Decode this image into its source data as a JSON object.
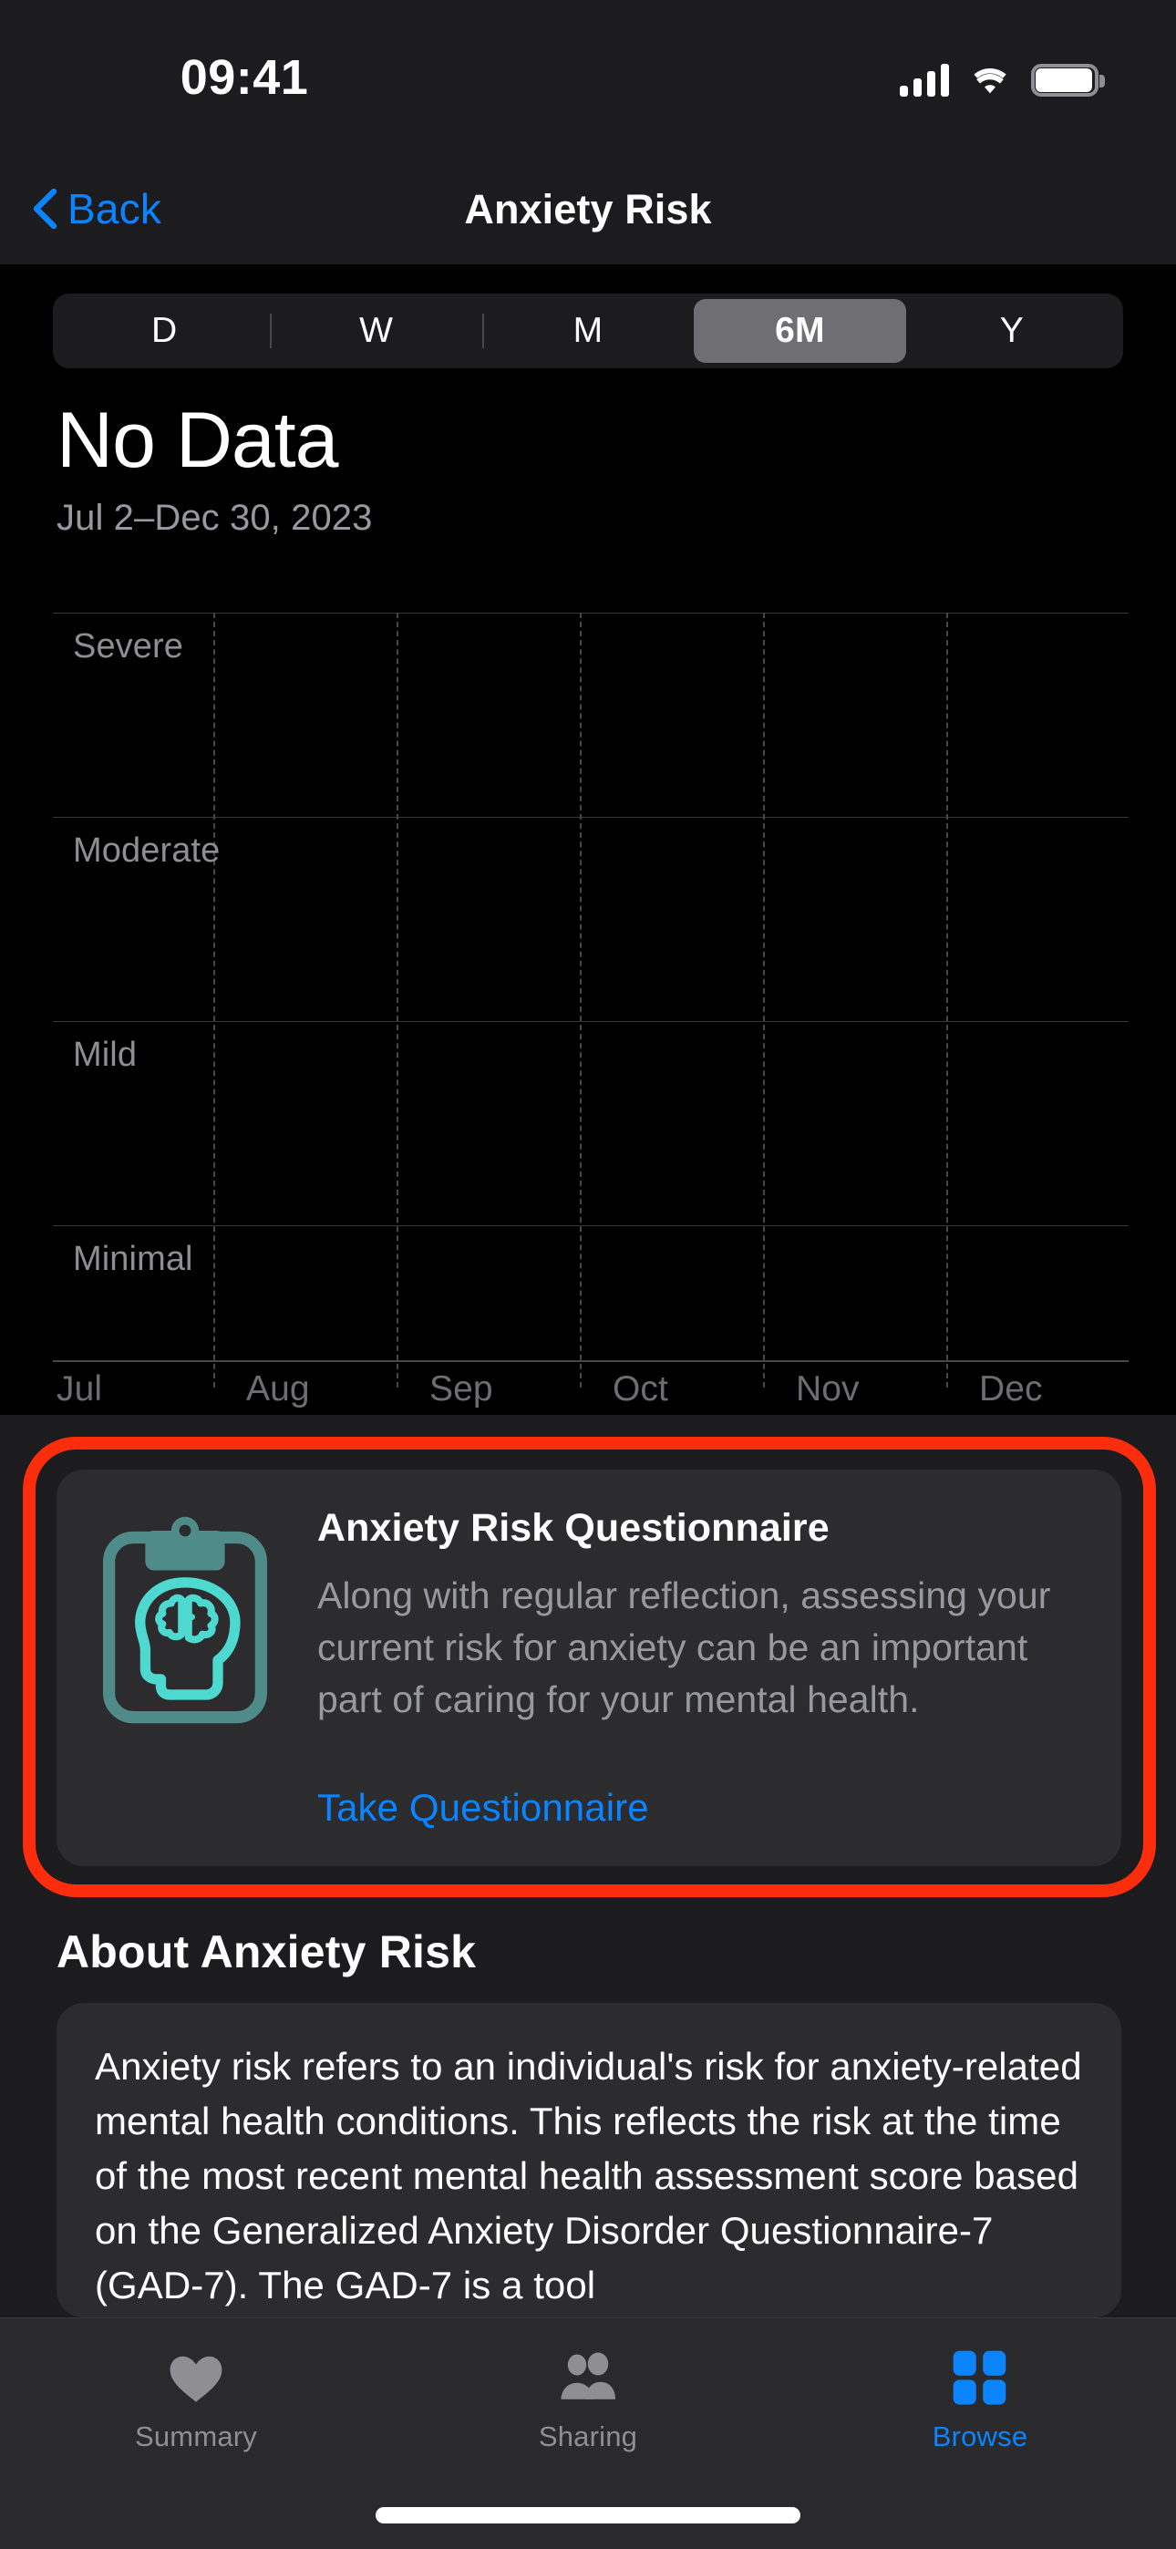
{
  "status_bar": {
    "time": "09:41",
    "cellular_icon": "cellular-bars-icon",
    "wifi_icon": "wifi-icon",
    "battery_icon": "battery-icon"
  },
  "nav_bar": {
    "back_label": "Back",
    "back_icon": "chevron-left-icon",
    "title": "Anxiety Risk"
  },
  "range_selector": {
    "options": [
      "D",
      "W",
      "M",
      "6M",
      "Y"
    ],
    "selected": "6M"
  },
  "summary": {
    "value": "No Data",
    "date_range": "Jul 2–Dec 30, 2023"
  },
  "chart_data": {
    "type": "line",
    "title": "No Data",
    "subtitle": "Jul 2–Dec 30, 2023",
    "xlabel": "",
    "ylabel": "",
    "x": [
      "Jul",
      "Aug",
      "Sep",
      "Oct",
      "Nov",
      "Dec"
    ],
    "xtick_labels": [
      "Jul",
      "Aug",
      "Sep",
      "Oct",
      "Nov",
      "Dec"
    ],
    "ytick_labels": [
      "Severe",
      "Moderate",
      "Mild",
      "Minimal"
    ],
    "ylim": [
      "Minimal",
      "Severe"
    ],
    "series": [
      {
        "name": "Anxiety Risk",
        "values": []
      }
    ],
    "has_data": false,
    "grid": {
      "horizontal": true,
      "vertical": true,
      "vertical_style": "dashed"
    },
    "legend": "none"
  },
  "questionnaire_card": {
    "icon": "clipboard-brain-icon",
    "title": "Anxiety Risk Questionnaire",
    "body": "Along with regular reflection, assessing your current risk for anxiety can be an important part of caring for your mental health.",
    "link_label": "Take Questionnaire"
  },
  "about_section": {
    "heading": "About Anxiety Risk",
    "body": "Anxiety risk refers to an individual's risk for anxiety-related mental health conditions. This reflects the risk at the time of the most recent mental health assessment score based on the Generalized Anxiety Disorder Questionnaire-7 (GAD-7). The GAD-7 is a tool"
  },
  "tab_bar": {
    "tabs": [
      {
        "label": "Summary",
        "icon": "heart-icon",
        "active": false
      },
      {
        "label": "Sharing",
        "icon": "people-icon",
        "active": false
      },
      {
        "label": "Browse",
        "icon": "grid-squares-icon",
        "active": true
      }
    ]
  },
  "colors": {
    "accent_blue": "#0a84ff",
    "highlight_red": "#fc2d0c",
    "icon_teal": "#4dd9d0",
    "card_bg": "#2c2c2e",
    "page_bg": "#1c1c1e",
    "chart_bg": "#000000"
  }
}
